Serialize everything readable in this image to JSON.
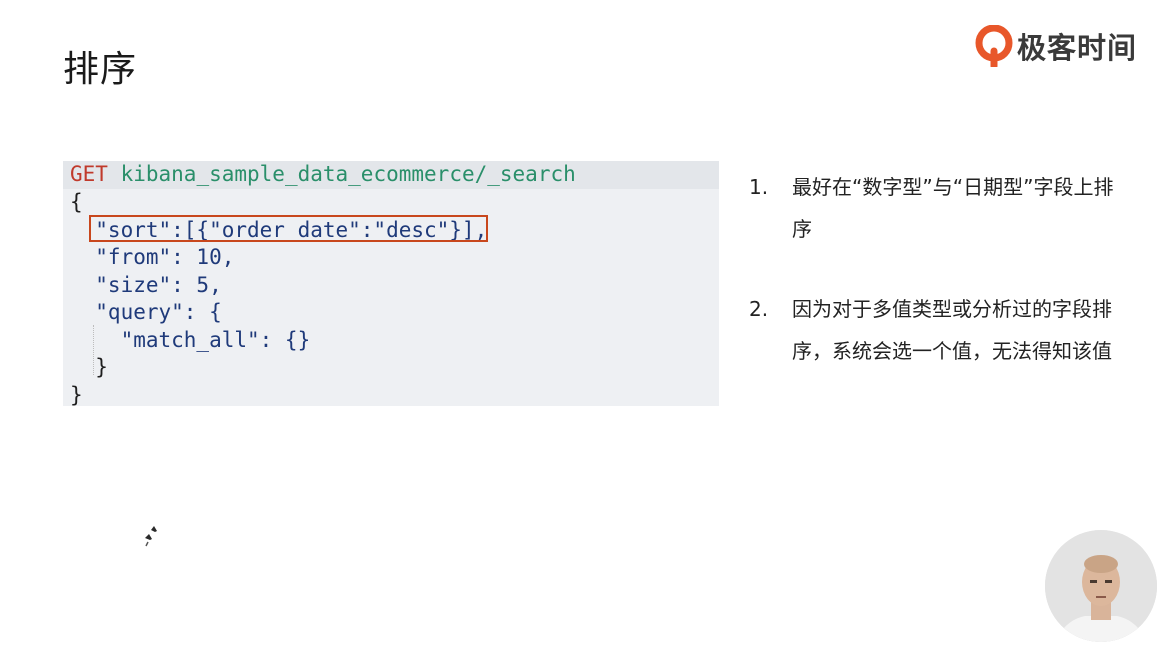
{
  "slide": {
    "title": "排序"
  },
  "brand": {
    "name": "极客时间",
    "logo_icon": "geektime-logo-icon",
    "accent": "#e8572a"
  },
  "code": {
    "method": "GET",
    "path": "kibana_sample_data_ecommerce/_search",
    "lines": [
      "{",
      "  \"sort\":[{\"order_date\":\"desc\"}],",
      "  \"from\": 10,",
      "  \"size\": 5,",
      "  \"query\": {",
      "    \"match_all\": {}",
      "  }",
      "}"
    ],
    "highlight_color": "#c8471d"
  },
  "notes": [
    {
      "num": "1.",
      "text": "最好在“数字型”与“日期型”字段上排序"
    },
    {
      "num": "2.",
      "text": "因为对于多值类型或分析过的字段排序，系统会选一个值，无法得知该值"
    }
  ],
  "presenter": {
    "icon": "presenter-video-avatar"
  }
}
